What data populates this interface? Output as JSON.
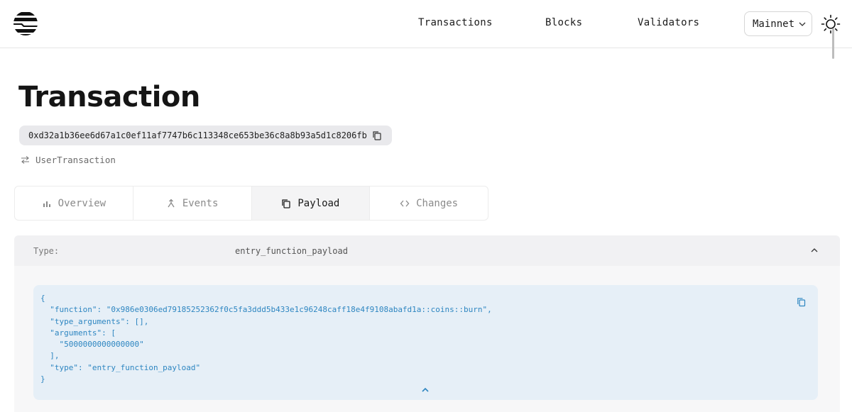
{
  "nav": {
    "transactions": "Transactions",
    "blocks": "Blocks",
    "validators": "Validators",
    "network": "Mainnet"
  },
  "page": {
    "title": "Transaction",
    "hash": "0xd32a1b36ee6d67a1c0ef11af7747b6c113348ce653be36c8a8b93a5d1c8206fb",
    "tx_type": "UserTransaction"
  },
  "tabs": [
    {
      "label": "Overview",
      "icon": "bar-chart-icon"
    },
    {
      "label": "Events",
      "icon": "merge-icon"
    },
    {
      "label": "Payload",
      "icon": "copy-icon"
    },
    {
      "label": "Changes",
      "icon": "code-icon"
    }
  ],
  "active_tab": "Payload",
  "payload": {
    "type_label": "Type:",
    "type_value": "entry_function_payload",
    "code": "{\n  \"function\": \"0x986e0306ed79185252362f0c5fa3ddd5b433e1c96248caff18e4f9108abafd1a::coins::burn\",\n  \"type_arguments\": [],\n  \"arguments\": [\n    \"5000000000000000\"\n  ],\n  \"type\": \"entry_function_payload\"\n}"
  },
  "colors": {
    "code_text": "#2e86c1",
    "code_bg": "#e6eff7",
    "hash_bg": "#e9e9ec"
  }
}
